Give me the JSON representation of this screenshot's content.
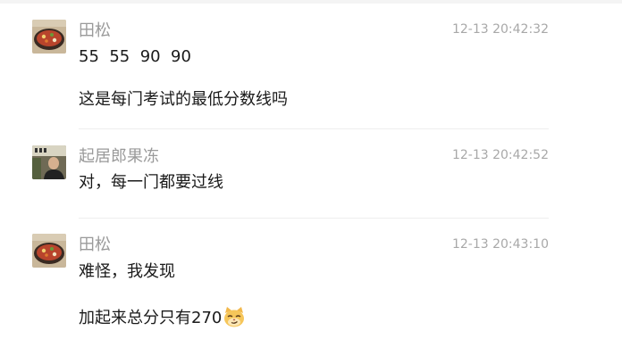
{
  "messages": [
    {
      "sender": "田松",
      "time": "12-13 20:42:32",
      "avatar_icon": "food-dish-avatar",
      "lines": [
        "55  55  90  90",
        "这是每门考试的最低分数线吗"
      ]
    },
    {
      "sender": "起居郎果冻",
      "time": "12-13 20:42:52",
      "avatar_icon": "person-photo-avatar",
      "lines": [
        "对，每一门都要过线"
      ]
    },
    {
      "sender": "田松",
      "time": "12-13 20:43:10",
      "avatar_icon": "food-dish-avatar",
      "lines": [
        "难怪，我发现",
        "加起来总分只有270"
      ],
      "emoji": "smirk-cat-emoji"
    }
  ]
}
